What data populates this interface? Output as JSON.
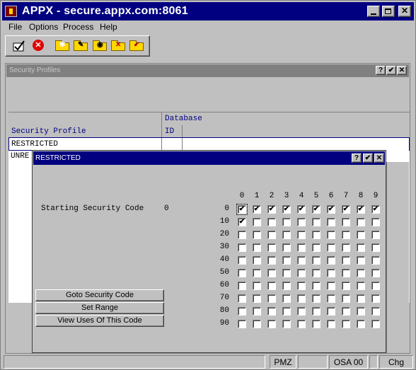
{
  "window": {
    "title": "APPX - secure.appx.com:8061",
    "icon": "appx-logo-icon"
  },
  "menu": {
    "file": "File",
    "options": "Options",
    "process": "Process",
    "help": "Help"
  },
  "toolbar": {
    "icons": [
      "check-icon",
      "cancel-icon",
      "folder-star-icon",
      "folder-edit-icon",
      "folder-search-icon",
      "folder-delete-icon",
      "folder-check-icon"
    ]
  },
  "profiles_window": {
    "title": "Security Profiles",
    "headers": {
      "profile": "Security Profile",
      "database": "Database",
      "id": "ID"
    },
    "rows": [
      "RESTRICTED",
      "UNRE"
    ]
  },
  "dialog": {
    "title": "RESTRICTED",
    "starting_label": "Starting Security Code",
    "starting_value": "0",
    "column_labels": [
      "0",
      "1",
      "2",
      "3",
      "4",
      "5",
      "6",
      "7",
      "8",
      "9"
    ],
    "row_labels": [
      "0",
      "10",
      "20",
      "30",
      "40",
      "50",
      "60",
      "70",
      "80",
      "90"
    ],
    "checked": [
      [
        true,
        true,
        true,
        true,
        true,
        true,
        true,
        true,
        true,
        true
      ],
      [
        true,
        false,
        false,
        false,
        false,
        false,
        false,
        false,
        false,
        false
      ],
      [
        false,
        false,
        false,
        false,
        false,
        false,
        false,
        false,
        false,
        false
      ],
      [
        false,
        false,
        false,
        false,
        false,
        false,
        false,
        false,
        false,
        false
      ],
      [
        false,
        false,
        false,
        false,
        false,
        false,
        false,
        false,
        false,
        false
      ],
      [
        false,
        false,
        false,
        false,
        false,
        false,
        false,
        false,
        false,
        false
      ],
      [
        false,
        false,
        false,
        false,
        false,
        false,
        false,
        false,
        false,
        false
      ],
      [
        false,
        false,
        false,
        false,
        false,
        false,
        false,
        false,
        false,
        false
      ],
      [
        false,
        false,
        false,
        false,
        false,
        false,
        false,
        false,
        false,
        false
      ],
      [
        false,
        false,
        false,
        false,
        false,
        false,
        false,
        false,
        false,
        false
      ]
    ],
    "buttons": {
      "goto": "Goto Security Code",
      "range": "Set Range",
      "uses": "View Uses Of This Code"
    }
  },
  "status": {
    "pmz": "PMZ",
    "osa": "OSA 00",
    "chg": "Chg"
  },
  "caption_glyphs": {
    "help": "?",
    "ok": "✔",
    "close": "✕"
  }
}
